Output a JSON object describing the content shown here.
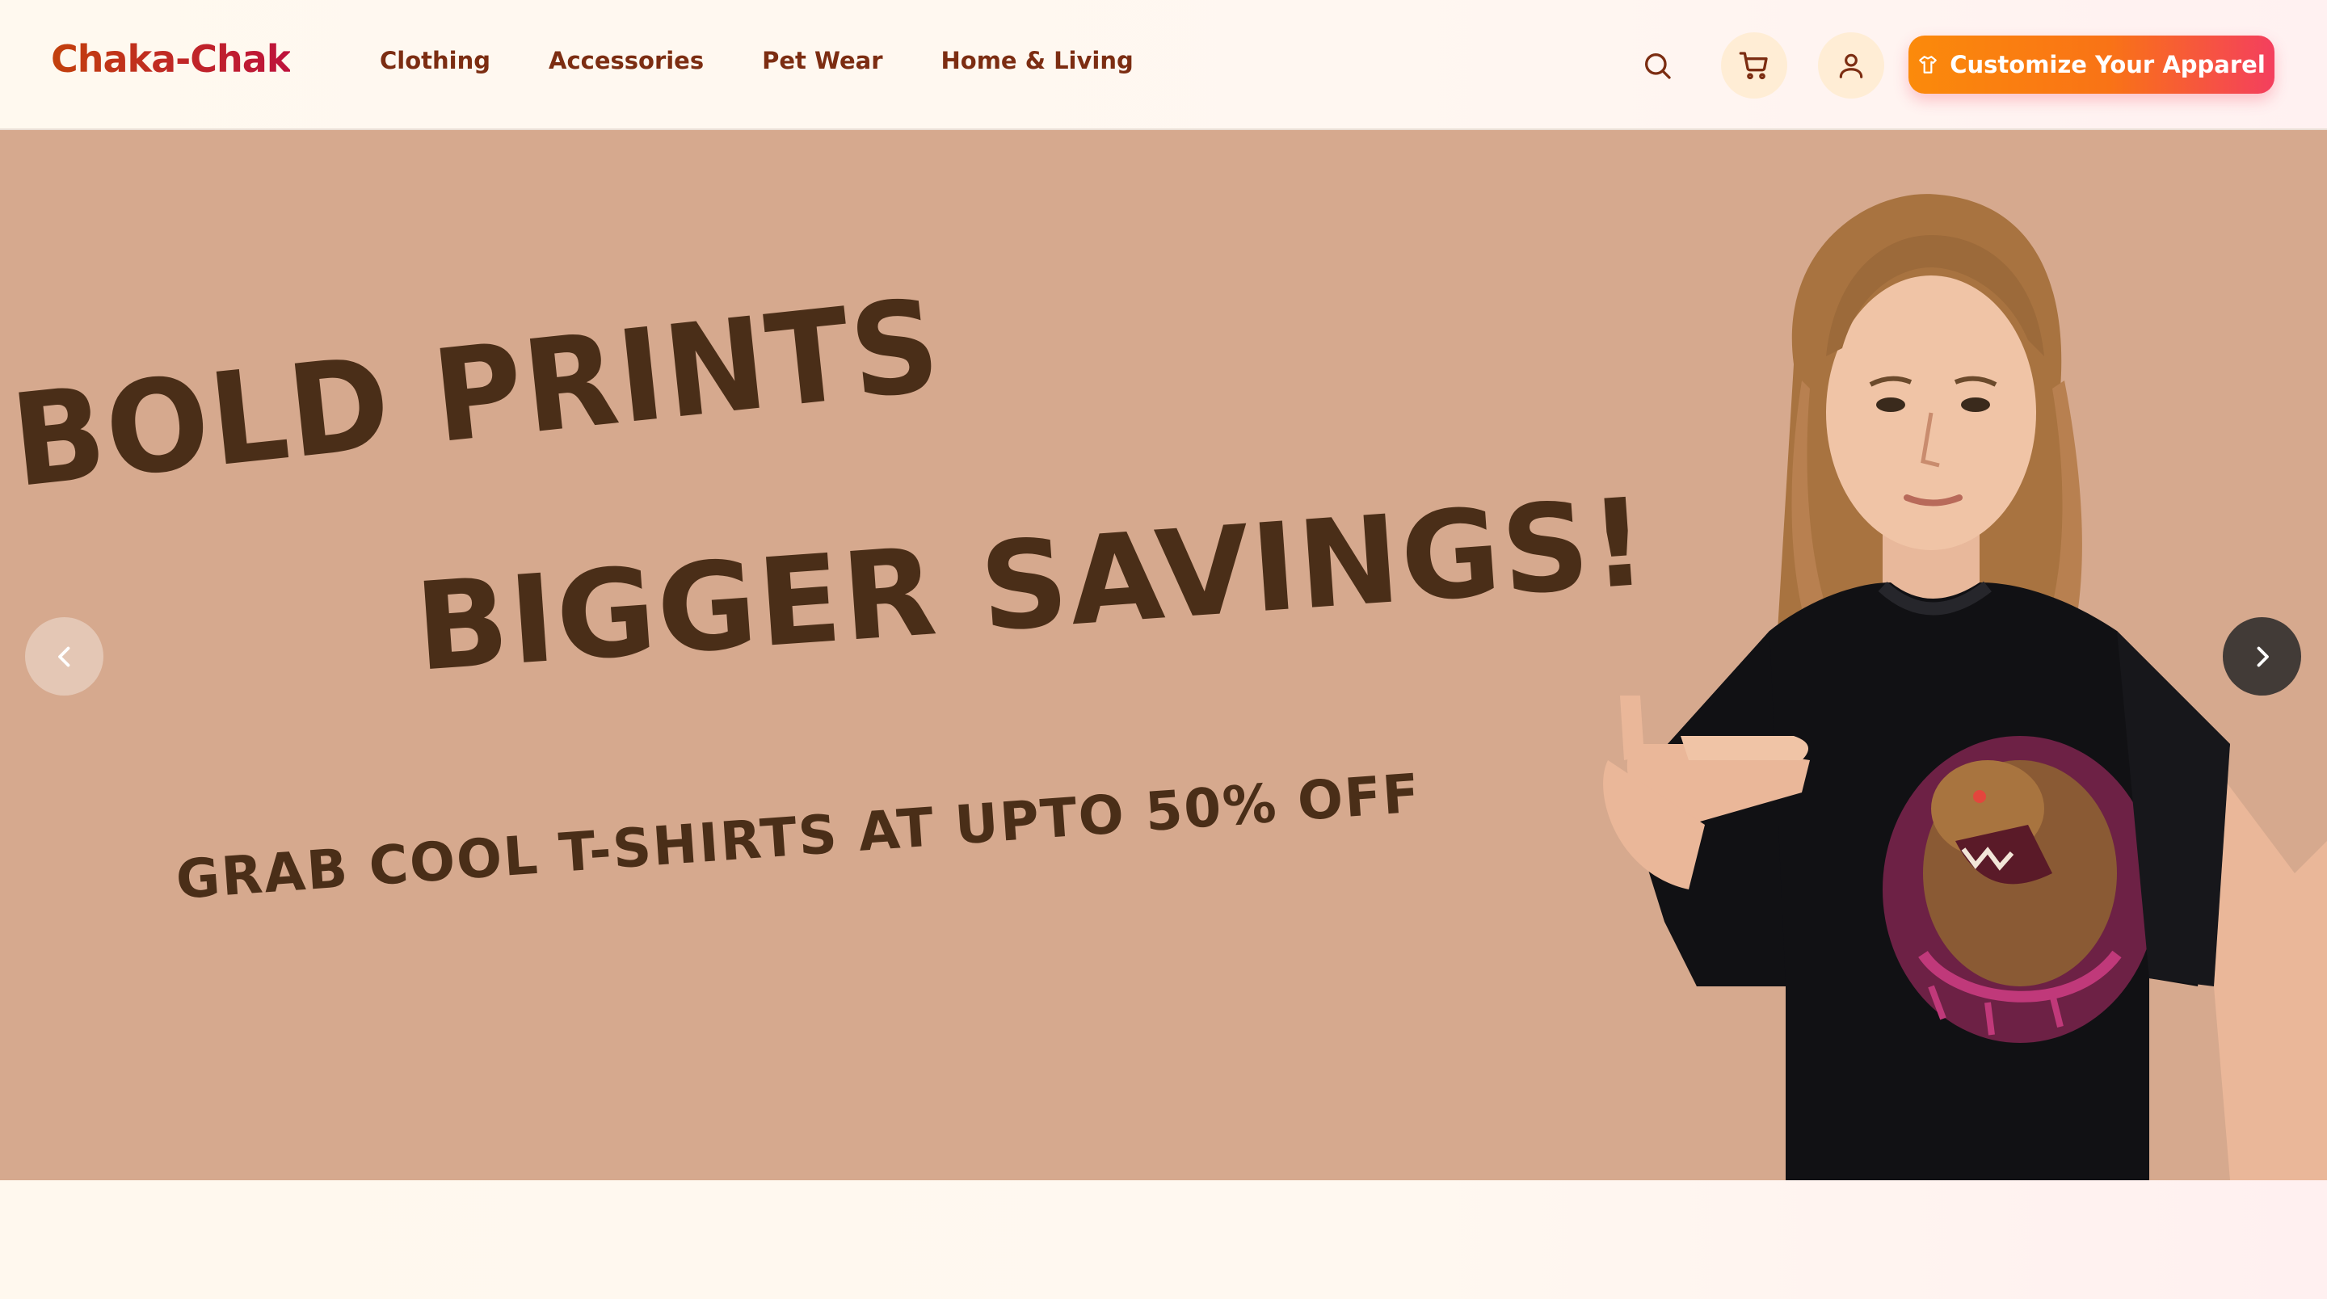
{
  "brand": {
    "name": "Chaka-Chak"
  },
  "nav": {
    "items": [
      {
        "label": "Clothing"
      },
      {
        "label": "Accessories"
      },
      {
        "label": "Pet Wear"
      },
      {
        "label": "Home & Living"
      }
    ]
  },
  "header": {
    "search_icon": "search-icon",
    "cart_icon": "cart-icon",
    "user_icon": "user-icon",
    "cta_label": "Customize Your Apparel",
    "cta_icon": "shirt-icon"
  },
  "hero": {
    "headline_line1": "BOLD PRINTS",
    "headline_line2": "BIGGER SAVINGS!",
    "subline": "GRAB COOL T-SHIRTS AT UPTO 50% OFF",
    "prev_icon": "chevron-left-icon",
    "next_icon": "chevron-right-icon"
  },
  "colors": {
    "brand_gradient_start": "#c2410c",
    "brand_gradient_end": "#be123c",
    "nav_text": "#7c2d12",
    "cta_start": "#fb8a0b",
    "cta_end": "#f43f5e",
    "hero_background": "#d6a98e",
    "hero_text": "#4a2e18"
  }
}
